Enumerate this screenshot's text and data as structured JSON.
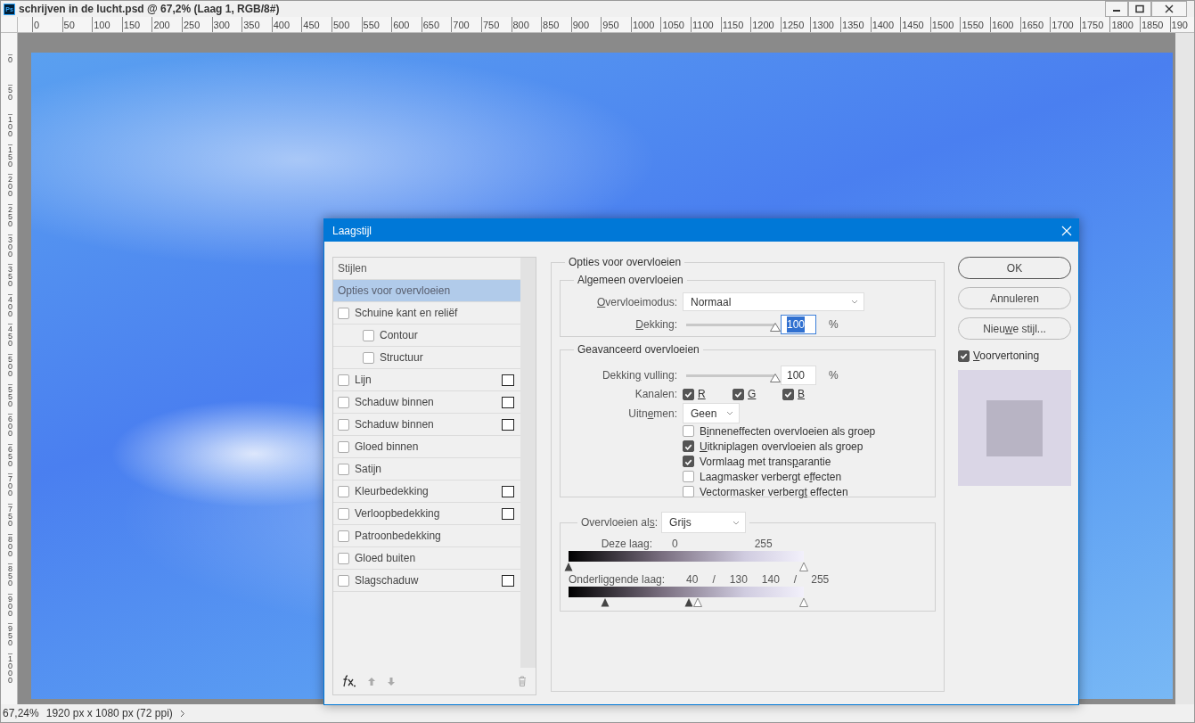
{
  "window": {
    "icon_label": "Ps",
    "title": "schrijven in de lucht.psd @ 67,2% (Laag 1, RGB/8#)"
  },
  "ruler_h": [
    "0",
    "50",
    "100",
    "150",
    "200",
    "250",
    "300",
    "350",
    "400",
    "450",
    "500",
    "550",
    "600",
    "650",
    "700",
    "750",
    "800",
    "850",
    "900",
    "950",
    "1000",
    "1050",
    "1100",
    "1150",
    "1200",
    "1250",
    "1300",
    "1350",
    "1400",
    "1450",
    "1500",
    "1550",
    "1600",
    "1650",
    "1700",
    "1750",
    "1800",
    "1850",
    "190"
  ],
  "ruler_v": [
    "0",
    "50",
    "100",
    "150",
    "200",
    "250",
    "300",
    "350",
    "400",
    "450",
    "500",
    "550",
    "600",
    "650",
    "700",
    "750",
    "800",
    "850",
    "900",
    "950",
    "1000"
  ],
  "dialog": {
    "title": "Laagstijl",
    "styles": [
      {
        "label": "Stijlen",
        "kind": "header",
        "selected": false
      },
      {
        "label": "Opties voor overvloeien",
        "kind": "header",
        "selected": true
      },
      {
        "label": "Schuine kant en reliëf",
        "kind": "effect",
        "checked": false,
        "selected": false,
        "addable": false,
        "children": [
          {
            "label": "Contour",
            "kind": "effect",
            "checked": false,
            "selected": false,
            "addable": false
          },
          {
            "label": "Structuur",
            "kind": "effect",
            "checked": false,
            "selected": false,
            "addable": false
          }
        ]
      },
      {
        "label": "Lijn",
        "kind": "effect",
        "checked": false,
        "selected": false,
        "addable": true
      },
      {
        "label": "Schaduw binnen",
        "kind": "effect",
        "checked": false,
        "selected": false,
        "addable": true
      },
      {
        "label": "Schaduw binnen",
        "kind": "effect",
        "checked": false,
        "selected": false,
        "addable": true
      },
      {
        "label": "Gloed binnen",
        "kind": "effect",
        "checked": false,
        "selected": false,
        "addable": false
      },
      {
        "label": "Satijn",
        "kind": "effect",
        "checked": false,
        "selected": false,
        "addable": false
      },
      {
        "label": "Kleurbedekking",
        "kind": "effect",
        "checked": false,
        "selected": false,
        "addable": true
      },
      {
        "label": "Verloopbedekking",
        "kind": "effect",
        "checked": false,
        "selected": false,
        "addable": true
      },
      {
        "label": "Patroonbedekking",
        "kind": "effect",
        "checked": false,
        "selected": false,
        "addable": false
      },
      {
        "label": "Gloed buiten",
        "kind": "effect",
        "checked": false,
        "selected": false,
        "addable": false
      },
      {
        "label": "Slagschaduw",
        "kind": "effect",
        "checked": false,
        "selected": false,
        "addable": true
      }
    ],
    "blending": {
      "title": "Opties voor overvloeien",
      "general": {
        "title": "Algemeen overvloeien",
        "mode": {
          "label": {
            "key": "O",
            "post": "vervloeimodus:"
          },
          "value": "Normaal"
        },
        "opacity": {
          "label": {
            "key": "D",
            "post": "ekking:"
          },
          "level": 1,
          "value": "100",
          "unit": "%",
          "selected": true
        }
      },
      "advanced": {
        "title": "Geavanceerd overvloeien",
        "fill": {
          "label": {
            "pre": "Dekkin",
            "key": "g",
            "post": " vulling:"
          },
          "level": 1,
          "value": "100",
          "unit": "%",
          "selected": false
        },
        "channels_label": "Kanalen:",
        "channels": [
          {
            "label": {
              "key": "R"
            },
            "checked": true
          },
          {
            "label": {
              "key": "G"
            },
            "checked": true
          },
          {
            "label": {
              "key": "B"
            },
            "checked": true
          }
        ],
        "knockout": {
          "label": {
            "pre": "Uitn",
            "key": "e",
            "post": "men:"
          },
          "value": "Geen"
        },
        "options": [
          {
            "label": {
              "pre": "B",
              "key": "i",
              "post": "nneneffecten overvloeien als groep"
            },
            "checked": false
          },
          {
            "label": {
              "key": "U",
              "post": "itkniplagen overvloeien als groep"
            },
            "checked": true
          },
          {
            "label": {
              "pre": "Vormlaag met trans",
              "key": "p",
              "post": "arantie"
            },
            "checked": true
          },
          {
            "label": {
              "pre": "Laagmasker verbergt e",
              "key": "f",
              "post": "fecten"
            },
            "checked": false
          },
          {
            "label": {
              "pre": "Vectormasker verberg",
              "key": "t",
              "post": " effecten"
            },
            "checked": false
          }
        ]
      },
      "blend_if": {
        "label": {
          "pre": "Overvloeien al",
          "key": "s",
          "post": ":"
        },
        "value": "Grijs",
        "this_layer": {
          "label": "Deze laag:",
          "readings": [
            "0",
            "255"
          ],
          "thumbs": [
            {
              "level": 0
            },
            {
              "level": 1
            }
          ]
        },
        "underlying": {
          "label": "Onderliggende laag:",
          "readings": [
            "40",
            "/",
            "130",
            "140",
            "/",
            "255"
          ],
          "thumbs": [
            {
              "level": 0.157
            },
            {
              "level": 0.51
            },
            {
              "level": 0.549
            },
            {
              "level": 1
            }
          ]
        }
      }
    },
    "buttons": [
      {
        "label": "OK",
        "default": true
      },
      {
        "label": "Annuleren",
        "default": false
      },
      {
        "label": {
          "pre": "Nieu",
          "key": "w",
          "post": "e stijl..."
        },
        "default": false
      }
    ],
    "preview": {
      "label": {
        "key": "V",
        "post": "oorvertoning"
      },
      "checked": true
    }
  },
  "status_bar": {
    "zoom": "67,24%",
    "info": "1920 px x 1080 px (72 ppi)"
  }
}
